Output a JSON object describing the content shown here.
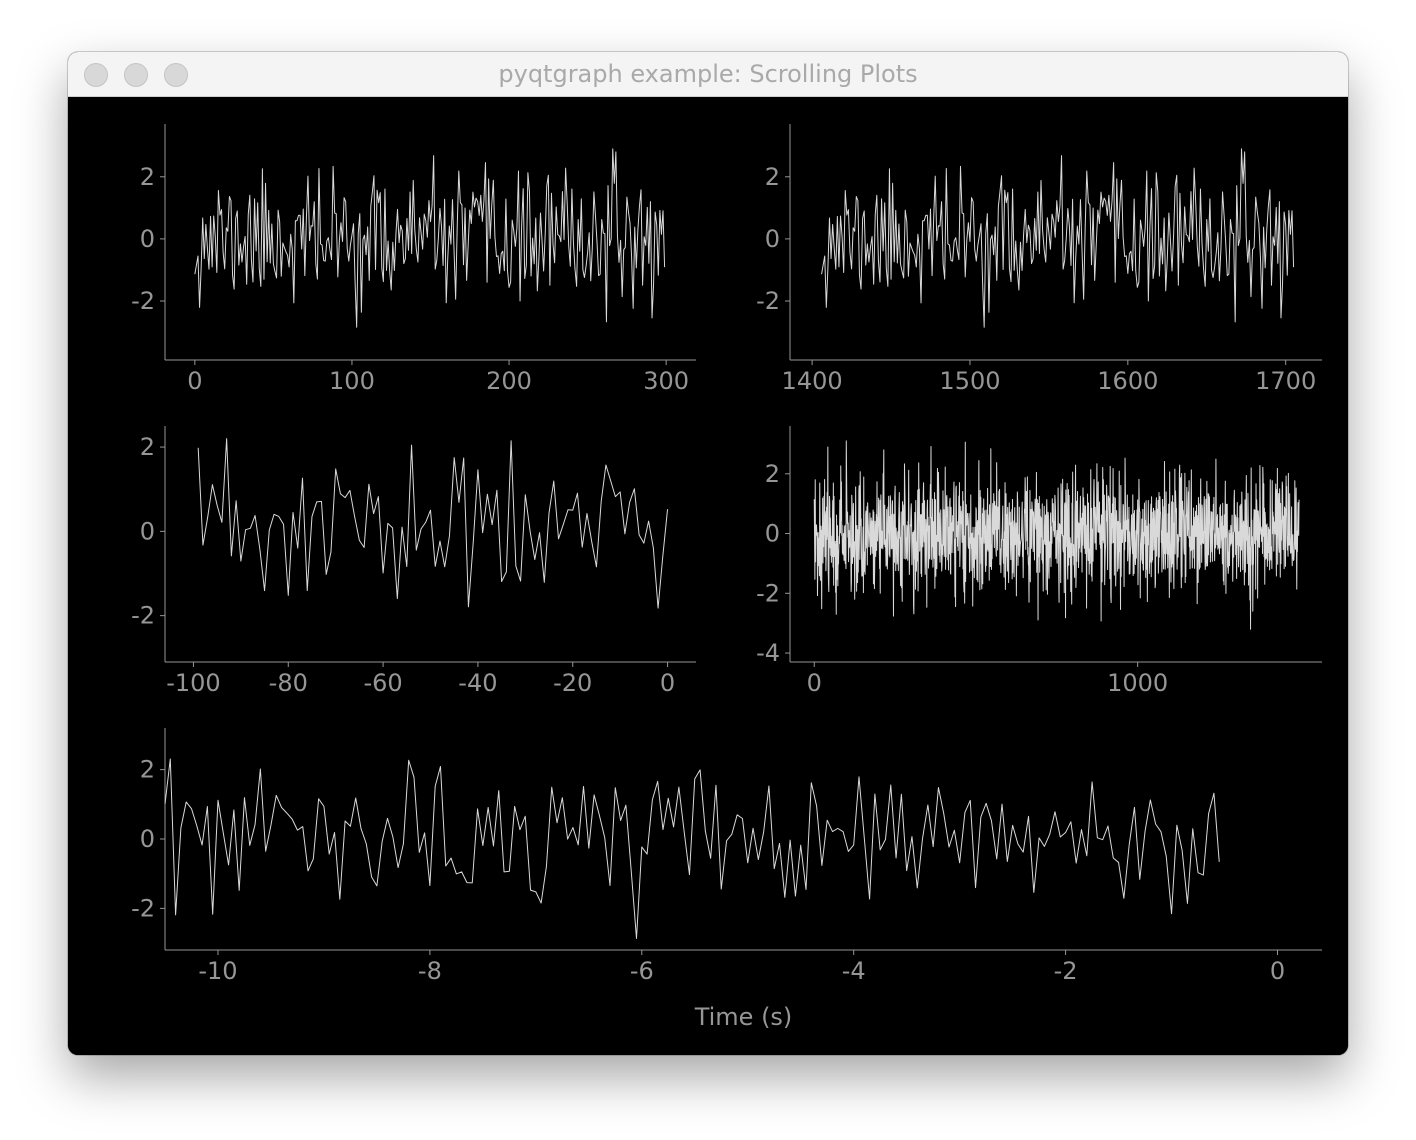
{
  "window": {
    "title": "pyqtgraph example: Scrolling Plots",
    "background": "#000000",
    "axis_color": "#969696",
    "trace_color": "#d9d9d9"
  },
  "chart_data": [
    {
      "type": "line",
      "title": "",
      "xlabel": "",
      "ylabel": "",
      "xlim": [
        -19,
        319
      ],
      "ylim": [
        -3.9,
        3.7
      ],
      "xticks": [
        0,
        100,
        200,
        300
      ],
      "yticks": [
        2,
        0,
        -2
      ],
      "n_points": 300,
      "x_start": 0,
      "x_step": 1,
      "seed": 11,
      "noise_std": 1.0,
      "grid": false
    },
    {
      "type": "line",
      "title": "",
      "xlabel": "",
      "ylabel": "",
      "xlim": [
        1386,
        1723
      ],
      "ylim": [
        -3.9,
        3.7
      ],
      "xticks": [
        1400,
        1500,
        1600,
        1700
      ],
      "yticks": [
        2,
        0,
        -2
      ],
      "n_points": 300,
      "x_start": 1406,
      "x_step": 1,
      "seed": 11,
      "noise_std": 1.0,
      "grid": false
    },
    {
      "type": "line",
      "title": "",
      "xlabel": "",
      "ylabel": "",
      "xlim": [
        -106,
        6
      ],
      "ylim": [
        -3.1,
        2.5
      ],
      "xticks": [
        -100,
        -80,
        -60,
        -40,
        -20,
        0
      ],
      "yticks": [
        2,
        0,
        -2
      ],
      "n_points": 100,
      "x_start": -99,
      "x_step": 1,
      "seed": 23,
      "noise_std": 1.0,
      "grid": false
    },
    {
      "type": "line",
      "title": "",
      "xlabel": "",
      "ylabel": "",
      "xlim": [
        -75,
        1570
      ],
      "ylim": [
        -4.3,
        3.6
      ],
      "xticks": [
        0,
        1000
      ],
      "yticks": [
        2,
        0,
        -2,
        -4
      ],
      "n_points": 1500,
      "x_start": 0,
      "x_step": 1,
      "seed": 37,
      "noise_std": 1.0,
      "grid": false
    },
    {
      "type": "line",
      "title": "",
      "xlabel": "Time (s)",
      "ylabel": "",
      "xlim": [
        -10.5,
        0.42
      ],
      "ylim": [
        -3.2,
        3.2
      ],
      "xticks": [
        -10,
        -8,
        -6,
        -4,
        -2,
        0
      ],
      "yticks": [
        2,
        0,
        -2
      ],
      "n_points": 200,
      "x_start": -10.5,
      "x_step": 0.05,
      "seed": 53,
      "noise_std": 1.0,
      "grid": false
    }
  ]
}
